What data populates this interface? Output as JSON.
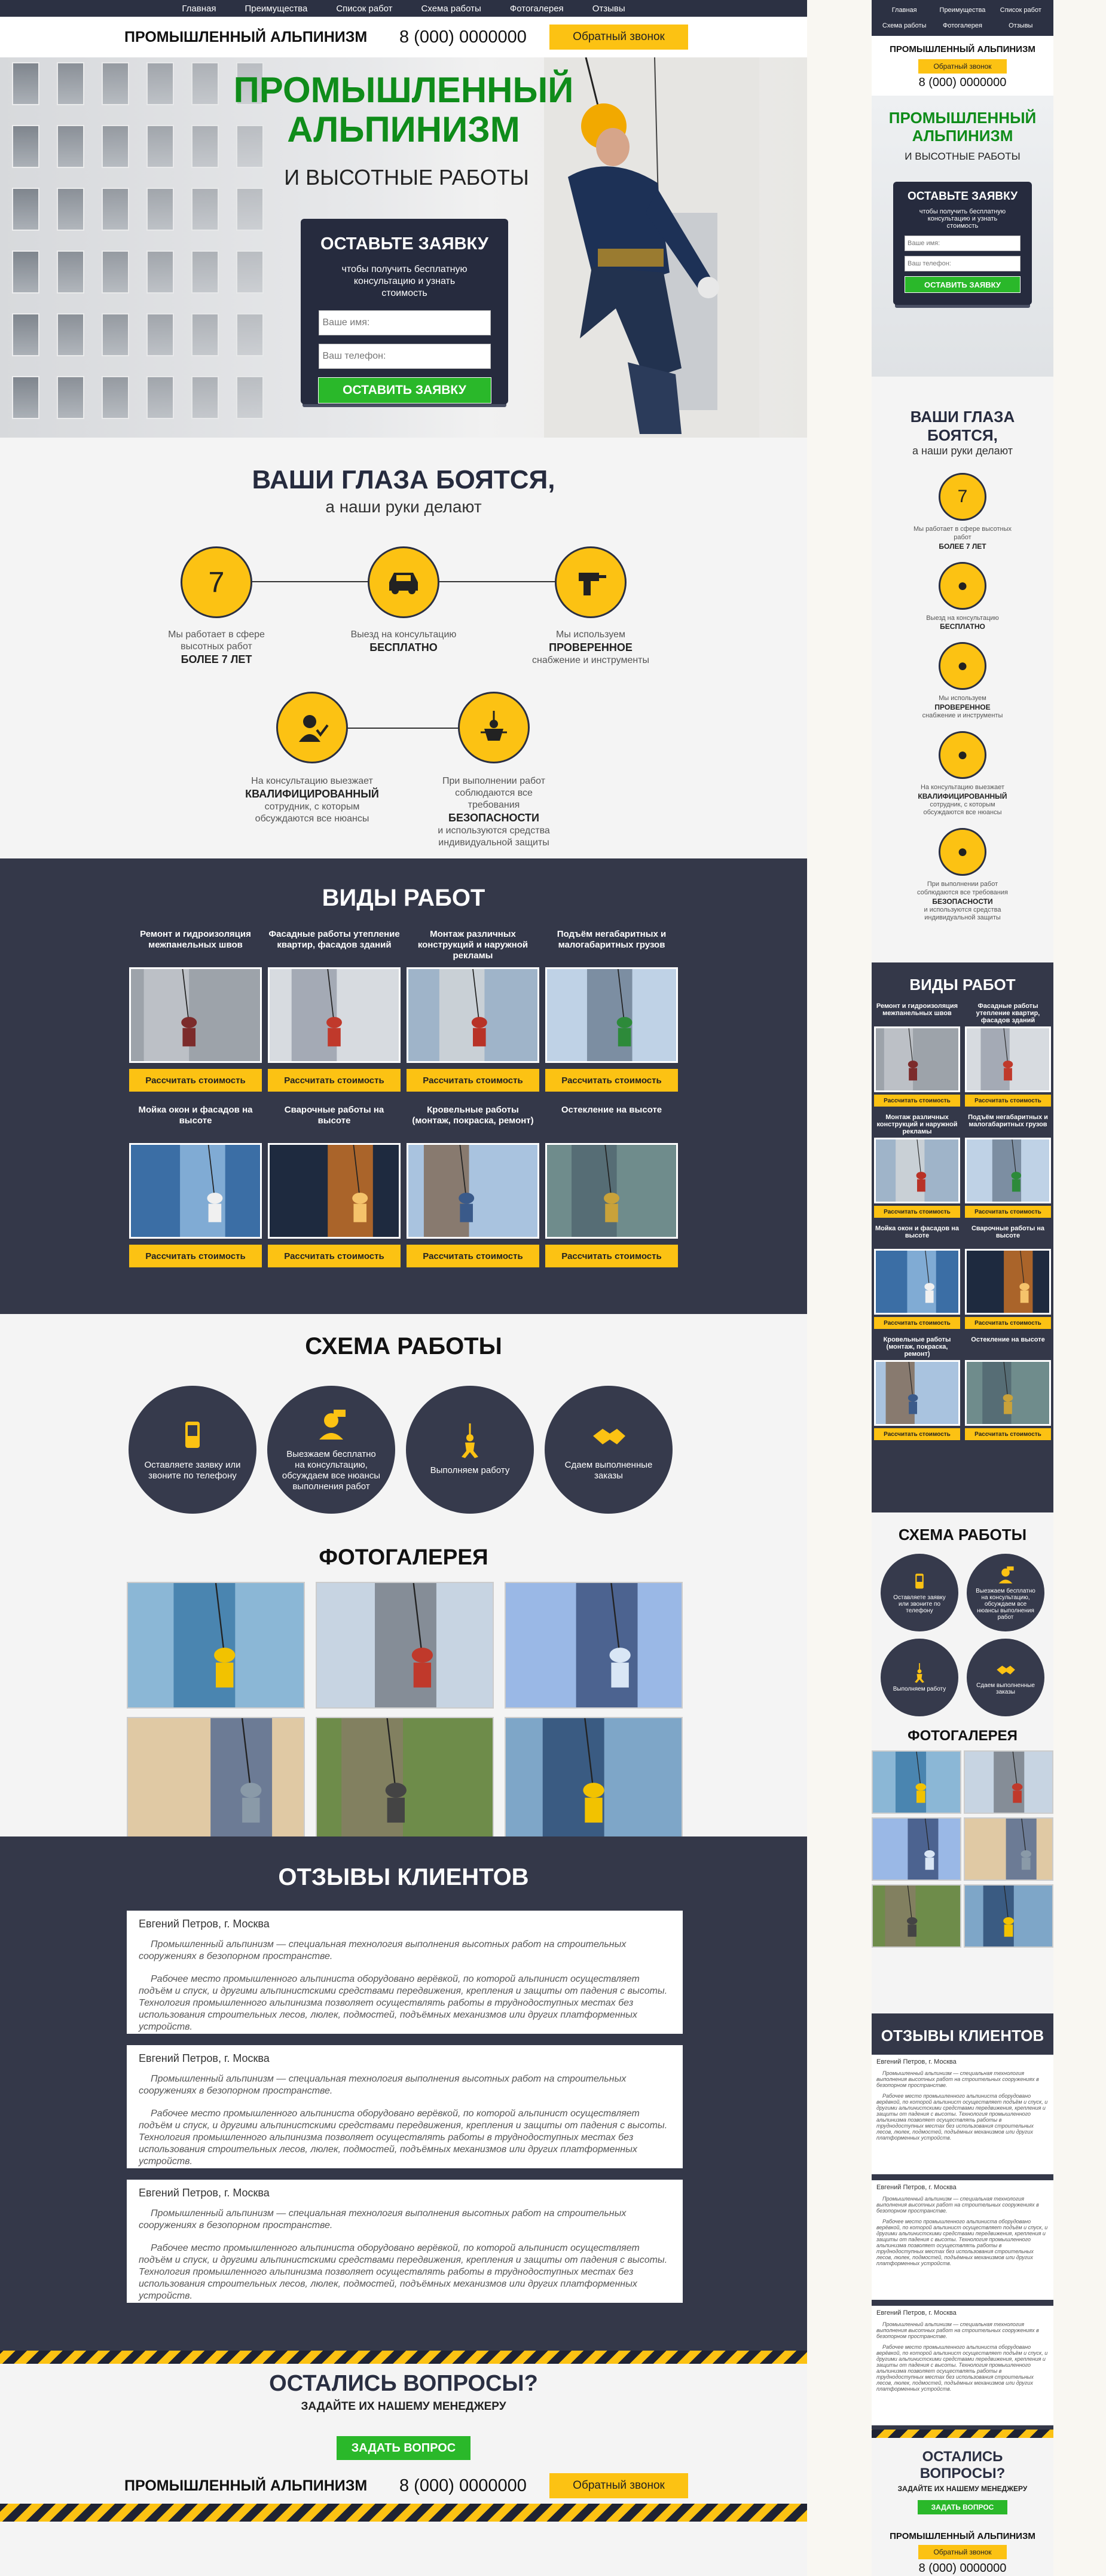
{
  "nav": [
    "Главная",
    "Преимущества",
    "Список работ",
    "Схема работы",
    "Фотогалерея",
    "Отзывы"
  ],
  "brand": "Промышленный альпинизм",
  "phone": "8 (000) 0000000",
  "callback": "Обратный звонок",
  "hero": {
    "title_line1": "Промышленный",
    "title_line2": "альпинизм",
    "subtitle": "и высотные работы"
  },
  "form": {
    "title": "Оставьте заявку",
    "text": "чтобы получить бесплатную консультацию и узнать стоимость",
    "name_placeholder": "Ваше имя:",
    "phone_placeholder": "Ваш телефон:",
    "submit": "Оставить заявку"
  },
  "features": {
    "title": "Ваши глаза боятся,",
    "subtitle": "а наши руки делают",
    "items": [
      {
        "icon": "seven-icon",
        "text": "Мы работает в сфере высотных работ",
        "bold": "более 7 лет",
        "after": ""
      },
      {
        "icon": "car-icon",
        "text": "Выезд на консультацию",
        "bold": "бесплатно",
        "after": ""
      },
      {
        "icon": "drill-icon",
        "text": "Мы используем",
        "bold": "проверенное",
        "after": "снабжение и инструменты"
      },
      {
        "icon": "expert-icon",
        "text": "На консультацию выезжает",
        "bold": "квалифицированный",
        "after": "сотрудник, с которым обсуждаются все нюансы"
      },
      {
        "icon": "safety-icon",
        "text": "При выполнении работ соблюдаются все требования",
        "bold": "безопасности",
        "after": "и используются средства индивидуальной защиты"
      }
    ]
  },
  "works": {
    "title": "Виды работ",
    "button": "Рассчитать стоимость",
    "items": [
      {
        "title": "Ремонт и гидроизоляция межпанельных швов",
        "image": "facade-seams-photo"
      },
      {
        "title": "Фасадные работы утепление квартир, фасадов зданий",
        "image": "facade-insulation-photo"
      },
      {
        "title": "Монтаж различных конструкций и наружной рекламы",
        "image": "mounting-photo"
      },
      {
        "title": "Подъём негабаритных и малогабаритных грузов",
        "image": "cargo-lifting-photo"
      },
      {
        "title": "Мойка окон и фасадов на высоте",
        "image": "window-washing-photo"
      },
      {
        "title": "Сварочные работы на высоте",
        "image": "welding-photo"
      },
      {
        "title": "Кровельные работы (монтаж, покраска, ремонт)",
        "image": "roofing-photo"
      },
      {
        "title": "Остекление на высоте",
        "image": "glazing-photo"
      }
    ]
  },
  "scheme": {
    "title": "Схема работы",
    "steps": [
      {
        "icon": "phone-icon",
        "text": "Оставляете заявку или звоните по телефону"
      },
      {
        "icon": "consultant-icon",
        "text": "Выезжаем бесплатно на консультацию, обсуждаем все нюансы выполнения работ"
      },
      {
        "icon": "climber-icon",
        "text": "Выполняем работу"
      },
      {
        "icon": "handshake-icon",
        "text": "Сдаем выполненные заказы"
      }
    ]
  },
  "gallery": {
    "title": "Фотогалерея",
    "images": [
      "gallery-photo-1",
      "gallery-photo-2",
      "gallery-photo-3",
      "gallery-photo-4",
      "gallery-photo-5",
      "gallery-photo-6"
    ]
  },
  "reviews": {
    "title": "Отзывы клиентов",
    "items": [
      {
        "name": "Евгений Петров, г. Москва",
        "p1": "Промышленный альпинизм — специальная технология выполнения высотных работ на строительных сооружениях в безопорном пространстве.",
        "p2": "Рабочее место промышленного альпиниста оборудовано верёвкой, по которой альпинист осуществляет подъём и спуск, и другими альпинистскими средствами передвижения, крепления и защиты от падения с высоты. Технология промышленного альпинизма позволяет осуществлять работы в труднодоступных местах без использования строительных лесов, люлек, подмостей, подъёмных механизмов или других платформенных устройств."
      },
      {
        "name": "Евгений Петров, г. Москва",
        "p1": "Промышленный альпинизм — специальная технология выполнения высотных работ на строительных сооружениях в безопорном пространстве.",
        "p2": "Рабочее место промышленного альпиниста оборудовано верёвкой, по которой альпинист осуществляет подъём и спуск, и другими альпинистскими средствами передвижения, крепления и защиты от падения с высоты. Технология промышленного альпинизма позволяет осуществлять работы в труднодоступных местах без использования строительных лесов, люлек, подмостей, подъёмных механизмов или других платформенных устройств."
      },
      {
        "name": "Евгений Петров, г. Москва",
        "p1": "Промышленный альпинизм — специальная технология выполнения высотных работ на строительных сооружениях в безопорном пространстве.",
        "p2": "Рабочее место промышленного альпиниста оборудовано верёвкой, по которой альпинист осуществляет подъём и спуск, и другими альпинистскими средствами передвижения, крепления и защиты от падения с высоты. Технология промышленного альпинизма позволяет осуществлять работы в труднодоступных местах без использования строительных лесов, люлек, подмостей, подъёмных механизмов или других платформенных устройств."
      }
    ]
  },
  "questions": {
    "title": "Остались вопросы?",
    "subtitle": "Задайте их нашему менеджеру",
    "button": "Задать вопрос"
  },
  "colors": {
    "yellow": "#fcc213",
    "dark": "#343849",
    "green": "#0f8c1a",
    "button_green": "#2ab82a"
  }
}
